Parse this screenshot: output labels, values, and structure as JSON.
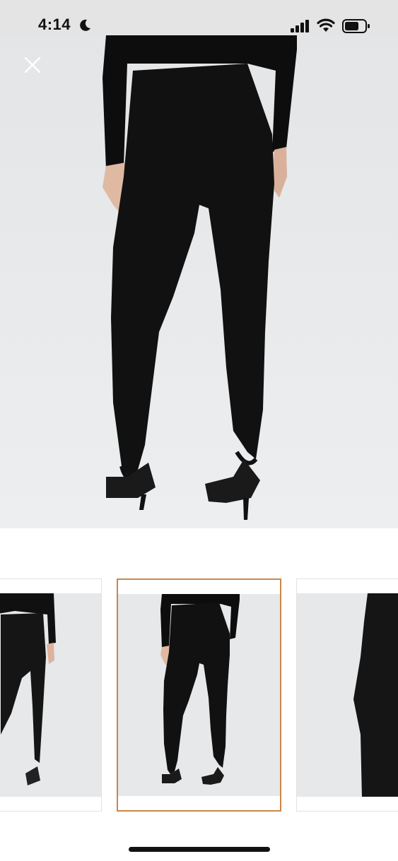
{
  "status_bar": {
    "time": "4:14",
    "icons": [
      "moon-icon",
      "cellular-signal-icon",
      "wifi-icon",
      "battery-icon"
    ]
  },
  "gallery": {
    "close_icon": "close-icon",
    "main_image": "product-photo-black-stirrup-leggings-back-view",
    "thumbnails": [
      {
        "image": "product-photo-front-view",
        "selected": false
      },
      {
        "image": "product-photo-back-view",
        "selected": true
      },
      {
        "image": "product-photo-side-view",
        "selected": false
      }
    ],
    "selected_border_color": "#c9874a"
  }
}
